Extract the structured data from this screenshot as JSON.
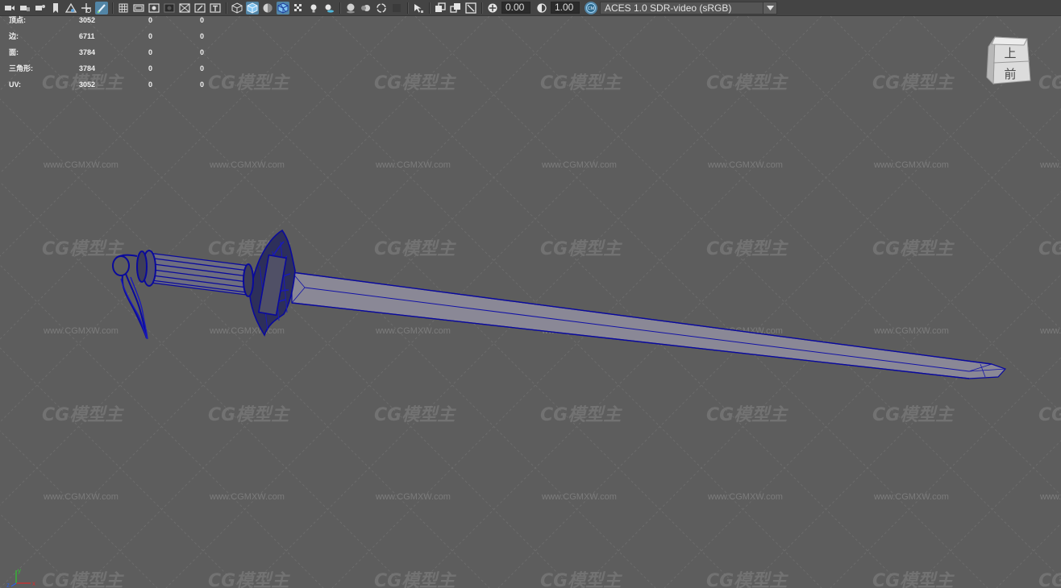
{
  "toolbar": {
    "icons": [
      "camera-icon",
      "camera-lock-icon",
      "camera-attrs-icon",
      "bookmark-icon",
      "image-plane-icon",
      "pan-zoom-icon",
      "grease-pencil-icon",
      "grid-icon",
      "film-gate-icon",
      "resolution-gate-icon",
      "gate-mask-icon",
      "field-chart-icon",
      "safe-action-icon",
      "safe-title-icon",
      "wireframe-icon",
      "smooth-shade-icon",
      "default-material-icon",
      "wireframe-on-shaded-icon",
      "textured-icon",
      "use-lights-icon",
      "shadows-icon",
      "screen-space-ao-icon",
      "motion-blur-icon",
      "anti-aliasing-icon",
      "depth-of-field-icon",
      "isolate-select-icon",
      "xray-icon",
      "xray-active-icon",
      "xray-joints-icon",
      "exposure-icon",
      "gamma-icon",
      "color-management-icon"
    ],
    "exposure_value": "0.00",
    "gamma_value": "1.00",
    "color_space": "ACES 1.0 SDR-video (sRGB)",
    "active_color": "#5285a6"
  },
  "hud": {
    "rows": [
      {
        "label": "顶点:",
        "v1": "3052",
        "v2": "0",
        "v3": "0"
      },
      {
        "label": "边:",
        "v1": "6711",
        "v2": "0",
        "v3": "0"
      },
      {
        "label": "面:",
        "v1": "3784",
        "v2": "0",
        "v3": "0"
      },
      {
        "label": "三角形:",
        "v1": "3784",
        "v2": "0",
        "v3": "0"
      },
      {
        "label": "UV:",
        "v1": "3052",
        "v2": "0",
        "v3": "0"
      }
    ]
  },
  "watermark": {
    "logo_text": "模型主",
    "logo_prefix": "CG",
    "url": "www.CGMXW.com"
  },
  "viewcube": {
    "top_face": "上",
    "front_face": "前"
  },
  "viewport": {
    "background": "#5d5d5d",
    "wire_color": "#0a0a9c",
    "blade_color": "#8a8896"
  },
  "axis": {
    "x": "x",
    "y": "y",
    "z": "z"
  }
}
